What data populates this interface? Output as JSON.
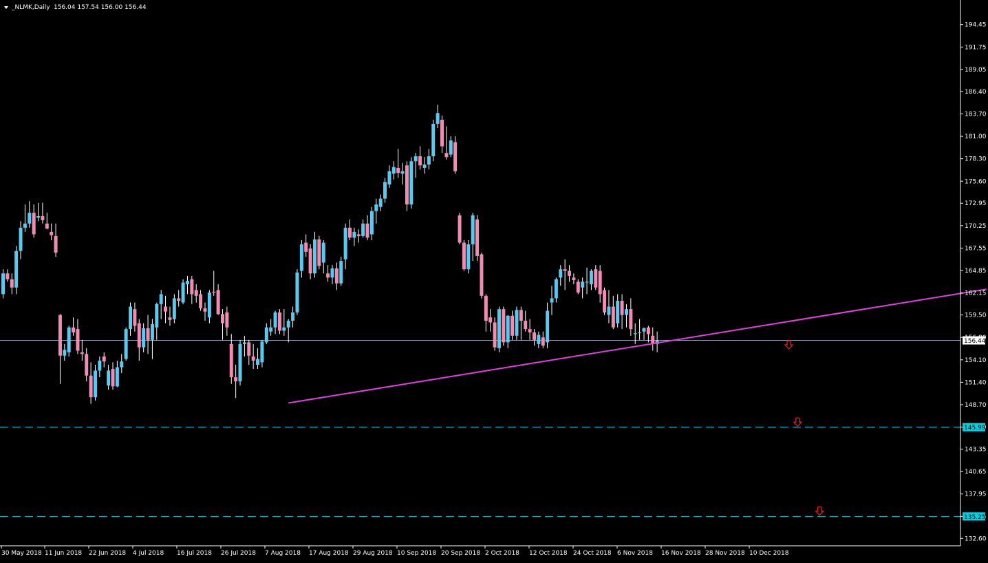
{
  "header": {
    "dropdown_icon": "triangle-down-icon",
    "title": "_NLMK,Daily",
    "ohlc": "156.04 157.54 156.00 156.44"
  },
  "colors": {
    "background": "#000000",
    "axis": "#FFFFFF",
    "bull_body": "#5BC8F0",
    "bear_body": "#F08CB4",
    "wick": "#FFFFFF",
    "trendline": "#E040E0",
    "level_line": "#00D0E0",
    "price_line": "#8FA0B8",
    "arrow": "#E02020"
  },
  "chart_data": {
    "type": "candlestick",
    "symbol": "_NLMK",
    "timeframe": "Daily",
    "ylim": [
      131.3,
      196.0
    ],
    "y_ticks": [
      "194.45",
      "191.75",
      "189.05",
      "186.40",
      "183.70",
      "181.00",
      "178.30",
      "175.60",
      "172.95",
      "170.25",
      "167.55",
      "164.85",
      "162.15",
      "159.50",
      "156.80",
      "154.10",
      "151.40",
      "148.70",
      "146.00",
      "143.35",
      "140.65",
      "137.95",
      "135.25",
      "132.60"
    ],
    "x_ticks": [
      "30 May 2018",
      "11 Jun 2018",
      "22 Jun 2018",
      "4 Jul 2018",
      "16 Jul 2018",
      "26 Jul 2018",
      "7 Aug 2018",
      "17 Aug 2018",
      "29 Aug 2018",
      "10 Sep 2018",
      "20 Sep 2018",
      "2 Oct 2018",
      "12 Oct 2018",
      "24 Oct 2018",
      "6 Nov 2018",
      "16 Nov 2018",
      "28 Nov 2018",
      "10 Dec 2018"
    ],
    "current_price": "156.44",
    "levels": [
      {
        "label": "145.99",
        "value": 145.99
      },
      {
        "label": "135.25",
        "value": 135.25
      }
    ],
    "trendline": {
      "from": [
        65,
        148.9
      ],
      "to": [
        224,
        162.6
      ]
    },
    "arrows": [
      {
        "bar": 179,
        "value": 155.9
      },
      {
        "bar": 181,
        "value": 146.6
      },
      {
        "bar": 186,
        "value": 135.9
      }
    ],
    "candles": [
      [
        0,
        162.0,
        165.0,
        161.5,
        164.5
      ],
      [
        1,
        164.5,
        165.0,
        163.5,
        163.8
      ],
      [
        2,
        163.8,
        164.5,
        162.0,
        162.8
      ],
      [
        3,
        162.8,
        167.8,
        162.0,
        167.2
      ],
      [
        4,
        167.2,
        170.8,
        166.2,
        170.0
      ],
      [
        5,
        170.0,
        172.8,
        169.5,
        170.5
      ],
      [
        6,
        170.5,
        173.2,
        170.0,
        171.8
      ],
      [
        7,
        171.8,
        172.8,
        168.8,
        169.2
      ],
      [
        8,
        171.2,
        173.0,
        170.8,
        171.4
      ],
      [
        9,
        171.4,
        173.0,
        170.5,
        170.9
      ],
      [
        10,
        170.5,
        171.8,
        169.8,
        169.9
      ],
      [
        11,
        169.5,
        170.5,
        168.5,
        169.1
      ],
      [
        12,
        169.0,
        170.5,
        166.5,
        167.0
      ],
      [
        13,
        159.5,
        159.6,
        151.2,
        154.6
      ],
      [
        14,
        154.6,
        156.0,
        154.0,
        155.3
      ],
      [
        15,
        155.0,
        158.2,
        154.5,
        158.0
      ],
      [
        16,
        158.0,
        159.2,
        157.0,
        157.4
      ],
      [
        17,
        157.8,
        159.0,
        154.8,
        155.2
      ],
      [
        18,
        155.0,
        156.5,
        154.0,
        154.8
      ],
      [
        19,
        154.8,
        155.5,
        151.5,
        152.2
      ],
      [
        20,
        152.2,
        153.8,
        148.8,
        149.6
      ],
      [
        21,
        149.6,
        153.5,
        149.2,
        152.8
      ],
      [
        22,
        152.8,
        154.5,
        152.0,
        154.0
      ],
      [
        23,
        154.5,
        155.0,
        153.2,
        153.9
      ],
      [
        24,
        151.0,
        153.5,
        150.5,
        152.8
      ],
      [
        25,
        153.0,
        153.8,
        150.5,
        150.9
      ],
      [
        26,
        150.9,
        154.0,
        150.8,
        153.2
      ],
      [
        27,
        153.2,
        154.8,
        152.5,
        153.9
      ],
      [
        28,
        154.2,
        158.0,
        154.0,
        157.8
      ],
      [
        29,
        157.8,
        161.0,
        157.0,
        160.5
      ],
      [
        30,
        160.2,
        161.0,
        157.5,
        158.2
      ],
      [
        31,
        158.5,
        159.0,
        154.0,
        155.6
      ],
      [
        32,
        155.6,
        158.5,
        155.0,
        157.9
      ],
      [
        33,
        157.9,
        159.5,
        154.8,
        156.5
      ],
      [
        34,
        156.5,
        159.0,
        154.2,
        158.4
      ],
      [
        35,
        158.0,
        161.0,
        156.5,
        160.8
      ],
      [
        36,
        160.8,
        162.5,
        159.0,
        162.0
      ],
      [
        37,
        160.5,
        161.8,
        158.5,
        159.9
      ],
      [
        38,
        159.2,
        160.5,
        158.2,
        158.9
      ],
      [
        39,
        159.0,
        162.0,
        158.5,
        161.5
      ],
      [
        40,
        161.5,
        162.5,
        160.5,
        161.2
      ],
      [
        41,
        161.0,
        163.8,
        160.8,
        163.4
      ],
      [
        42,
        163.2,
        164.2,
        162.0,
        163.6
      ],
      [
        43,
        163.8,
        164.2,
        160.8,
        162.0
      ],
      [
        44,
        162.5,
        163.2,
        161.0,
        161.8
      ],
      [
        45,
        162.0,
        162.5,
        160.0,
        160.3
      ],
      [
        46,
        160.3,
        161.0,
        158.8,
        159.9
      ],
      [
        47,
        159.2,
        162.5,
        158.5,
        162.2
      ],
      [
        48,
        162.3,
        164.8,
        161.8,
        162.2
      ],
      [
        49,
        162.5,
        163.2,
        159.5,
        159.6
      ],
      [
        50,
        159.6,
        160.2,
        156.5,
        158.5
      ],
      [
        51,
        159.8,
        160.5,
        157.0,
        158.0
      ],
      [
        52,
        156.0,
        157.2,
        151.2,
        152.0
      ],
      [
        53,
        152.0,
        153.5,
        149.5,
        151.5
      ],
      [
        54,
        151.5,
        156.5,
        151.0,
        156.0
      ],
      [
        55,
        156.0,
        157.0,
        154.5,
        156.2
      ],
      [
        56,
        156.2,
        156.5,
        153.5,
        154.6
      ],
      [
        57,
        154.5,
        156.0,
        153.0,
        154.0
      ],
      [
        58,
        153.5,
        155.5,
        153.0,
        154.2
      ],
      [
        59,
        153.8,
        156.5,
        153.2,
        156.3
      ],
      [
        60,
        156.2,
        158.5,
        156.0,
        158.0
      ],
      [
        61,
        157.5,
        159.0,
        157.0,
        158.0
      ],
      [
        62,
        158.0,
        160.0,
        157.2,
        159.8
      ],
      [
        63,
        159.8,
        160.2,
        157.2,
        157.6
      ],
      [
        64,
        157.6,
        160.2,
        157.0,
        158.0
      ],
      [
        65,
        158.0,
        159.0,
        156.2,
        158.8
      ],
      [
        66,
        158.8,
        160.5,
        158.0,
        159.8
      ],
      [
        67,
        159.8,
        165.0,
        159.5,
        164.6
      ],
      [
        68,
        164.8,
        168.5,
        164.0,
        168.0
      ],
      [
        69,
        168.2,
        169.2,
        166.5,
        167.1
      ],
      [
        70,
        167.5,
        168.0,
        163.8,
        164.5
      ],
      [
        71,
        164.5,
        169.5,
        164.0,
        168.6
      ],
      [
        72,
        168.6,
        169.0,
        165.0,
        165.4
      ],
      [
        73,
        165.8,
        168.5,
        164.5,
        168.2
      ],
      [
        74,
        164.5,
        165.5,
        163.5,
        164.0
      ],
      [
        75,
        164.0,
        165.5,
        163.2,
        165.1
      ],
      [
        76,
        165.1,
        165.8,
        162.5,
        163.3
      ],
      [
        77,
        163.3,
        166.5,
        163.0,
        166.0
      ],
      [
        78,
        166.2,
        170.5,
        165.0,
        170.0
      ],
      [
        79,
        170.0,
        171.0,
        168.5,
        168.8
      ],
      [
        80,
        168.8,
        170.0,
        167.8,
        169.5
      ],
      [
        81,
        169.2,
        169.8,
        168.2,
        169.0
      ],
      [
        82,
        169.0,
        171.0,
        168.8,
        170.5
      ],
      [
        83,
        170.5,
        171.5,
        168.5,
        168.8
      ],
      [
        84,
        169.2,
        172.5,
        168.5,
        172.0
      ],
      [
        85,
        172.0,
        173.5,
        170.5,
        172.8
      ],
      [
        86,
        172.5,
        174.0,
        172.0,
        173.5
      ],
      [
        87,
        173.5,
        176.0,
        173.0,
        175.5
      ],
      [
        88,
        175.2,
        177.5,
        174.8,
        176.8
      ],
      [
        89,
        176.5,
        178.0,
        175.8,
        177.3
      ],
      [
        90,
        177.2,
        179.5,
        176.0,
        176.6
      ],
      [
        91,
        176.5,
        177.8,
        175.2,
        176.8
      ],
      [
        92,
        177.5,
        178.0,
        172.0,
        172.8
      ],
      [
        93,
        172.8,
        178.5,
        172.3,
        178.0
      ],
      [
        94,
        178.0,
        179.0,
        176.0,
        178.6
      ],
      [
        95,
        178.6,
        179.8,
        177.0,
        177.5
      ],
      [
        96,
        177.2,
        178.5,
        176.5,
        177.6
      ],
      [
        97,
        177.6,
        179.5,
        177.0,
        178.6
      ],
      [
        98,
        178.6,
        183.0,
        178.0,
        182.5
      ],
      [
        99,
        182.5,
        184.8,
        182.0,
        183.8
      ],
      [
        100,
        183.0,
        183.5,
        179.0,
        179.8
      ],
      [
        101,
        179.0,
        182.2,
        178.2,
        178.5
      ],
      [
        102,
        178.8,
        181.0,
        178.5,
        180.5
      ],
      [
        103,
        180.3,
        181.0,
        176.5,
        176.8
      ],
      [
        104,
        171.5,
        171.8,
        168.0,
        168.2
      ],
      [
        105,
        168.2,
        168.5,
        164.8,
        165.0
      ],
      [
        106,
        165.0,
        168.5,
        164.5,
        168.0
      ],
      [
        107,
        168.0,
        171.8,
        166.0,
        171.5
      ],
      [
        108,
        171.0,
        171.5,
        166.0,
        166.6
      ],
      [
        109,
        166.8,
        167.0,
        161.5,
        161.8
      ],
      [
        110,
        161.8,
        162.0,
        157.5,
        158.8
      ],
      [
        111,
        159.2,
        160.2,
        157.5,
        158.6
      ],
      [
        112,
        158.6,
        159.2,
        155.2,
        155.6
      ],
      [
        113,
        155.5,
        160.5,
        155.0,
        160.2
      ],
      [
        114,
        160.2,
        160.5,
        155.8,
        156.2
      ],
      [
        115,
        156.2,
        159.5,
        155.5,
        159.4
      ],
      [
        116,
        159.4,
        160.0,
        156.5,
        157.0
      ],
      [
        117,
        157.0,
        160.5,
        156.5,
        160.1
      ],
      [
        118,
        160.1,
        160.5,
        156.5,
        158.8
      ],
      [
        119,
        158.8,
        160.0,
        157.5,
        157.8
      ],
      [
        120,
        157.8,
        159.0,
        156.5,
        157.4
      ],
      [
        121,
        157.4,
        157.8,
        155.8,
        156.5
      ],
      [
        122,
        156.0,
        157.5,
        155.5,
        157.1
      ],
      [
        123,
        156.8,
        157.5,
        155.5,
        155.8
      ],
      [
        124,
        156.2,
        161.0,
        155.5,
        160.0
      ],
      [
        125,
        161.0,
        163.0,
        159.5,
        161.5
      ],
      [
        126,
        161.5,
        164.0,
        161.0,
        163.8
      ],
      [
        127,
        164.0,
        165.5,
        163.0,
        165.0
      ],
      [
        128,
        165.0,
        166.2,
        162.5,
        164.8
      ],
      [
        129,
        164.8,
        165.5,
        163.5,
        164.2
      ],
      [
        130,
        164.0,
        164.5,
        163.2,
        163.7
      ],
      [
        131,
        163.5,
        163.8,
        162.0,
        162.2
      ],
      [
        132,
        162.8,
        164.0,
        161.5,
        163.5
      ],
      [
        133,
        163.5,
        165.2,
        162.0,
        163.5
      ],
      [
        134,
        163.2,
        165.0,
        162.5,
        164.8
      ],
      [
        135,
        165.0,
        165.5,
        162.5,
        162.8
      ],
      [
        136,
        164.8,
        165.5,
        161.0,
        162.0
      ],
      [
        137,
        162.5,
        162.8,
        159.5,
        159.8
      ],
      [
        138,
        159.5,
        162.5,
        158.5,
        160.5
      ],
      [
        139,
        160.5,
        161.8,
        157.8,
        158.0
      ],
      [
        140,
        158.5,
        162.0,
        158.0,
        161.2
      ],
      [
        141,
        161.2,
        162.0,
        157.8,
        159.5
      ],
      [
        142,
        159.5,
        160.8,
        158.0,
        160.2
      ],
      [
        143,
        160.2,
        161.5,
        157.0,
        157.8
      ],
      [
        144,
        157.2,
        158.5,
        156.0,
        157.3
      ],
      [
        145,
        157.3,
        159.0,
        156.5,
        157.4
      ],
      [
        146,
        157.5,
        158.0,
        156.5,
        157.9
      ],
      [
        147,
        158.0,
        158.2,
        156.2,
        157.2
      ],
      [
        148,
        157.0,
        158.0,
        155.2,
        156.1
      ],
      [
        149,
        156.0,
        157.5,
        155.0,
        156.4
      ]
    ]
  }
}
